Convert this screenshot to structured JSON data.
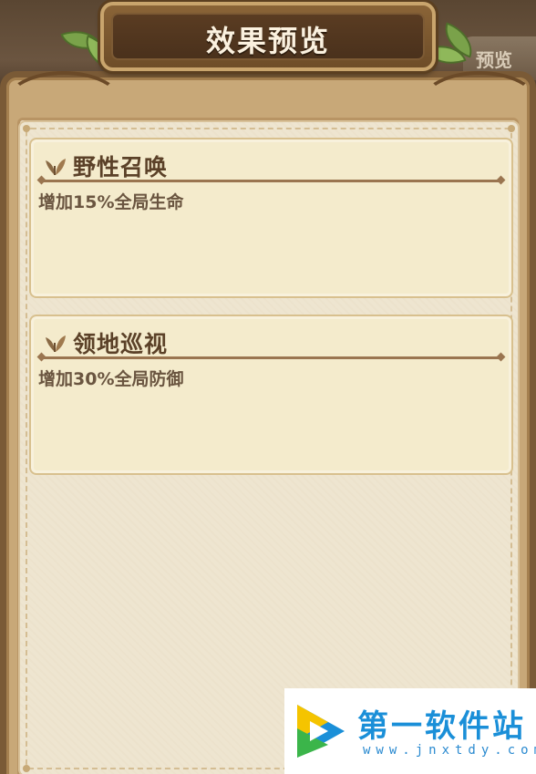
{
  "header": {
    "title": "效果预览"
  },
  "background_tab": {
    "label": "预览"
  },
  "effects": [
    {
      "name": "野性召唤",
      "description": "增加15%全局生命",
      "icon": "sprout-icon"
    },
    {
      "name": "领地巡视",
      "description": "增加30%全局防御",
      "icon": "sprout-icon"
    }
  ],
  "watermark": {
    "name": "第一软件站",
    "url": "www.jnxtdy.com"
  },
  "colors": {
    "frame_wood": "#7a5a36",
    "plaque_dark": "#4a311c",
    "paper": "#eee5d0",
    "card_bg": "#f4ebcc",
    "title_text": "#5b4128",
    "desc_text": "#6a5540",
    "watermark_blue": "#1a8fd8"
  }
}
